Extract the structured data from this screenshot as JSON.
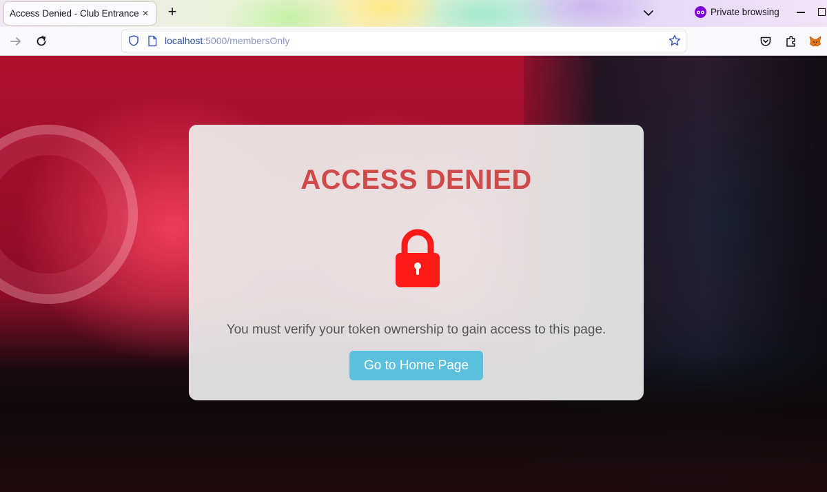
{
  "browser": {
    "tab_title": "Access Denied - Club Entrance",
    "tab_close": "×",
    "new_tab": "+",
    "private_label": "Private browsing",
    "url_host": "localhost",
    "url_rest": ":5000/membersOnly",
    "icons": [
      "close-icon",
      "plus-icon",
      "chevron-down-icon",
      "private-mask-icon",
      "minimize-icon",
      "maximize-icon",
      "forward-arrow-icon",
      "reload-icon",
      "shield-icon",
      "page-icon",
      "star-icon",
      "pocket-icon",
      "extensions-icon",
      "metamask-fox-icon"
    ]
  },
  "page": {
    "title": "ACCESS DENIED",
    "message": "You must verify your token ownership to gain access to this page.",
    "home_button": "Go to Home Page",
    "colors": {
      "title": "#d14a4a",
      "lock": "#ff1a1a",
      "button": "#5bc0de",
      "message": "#555555"
    }
  }
}
